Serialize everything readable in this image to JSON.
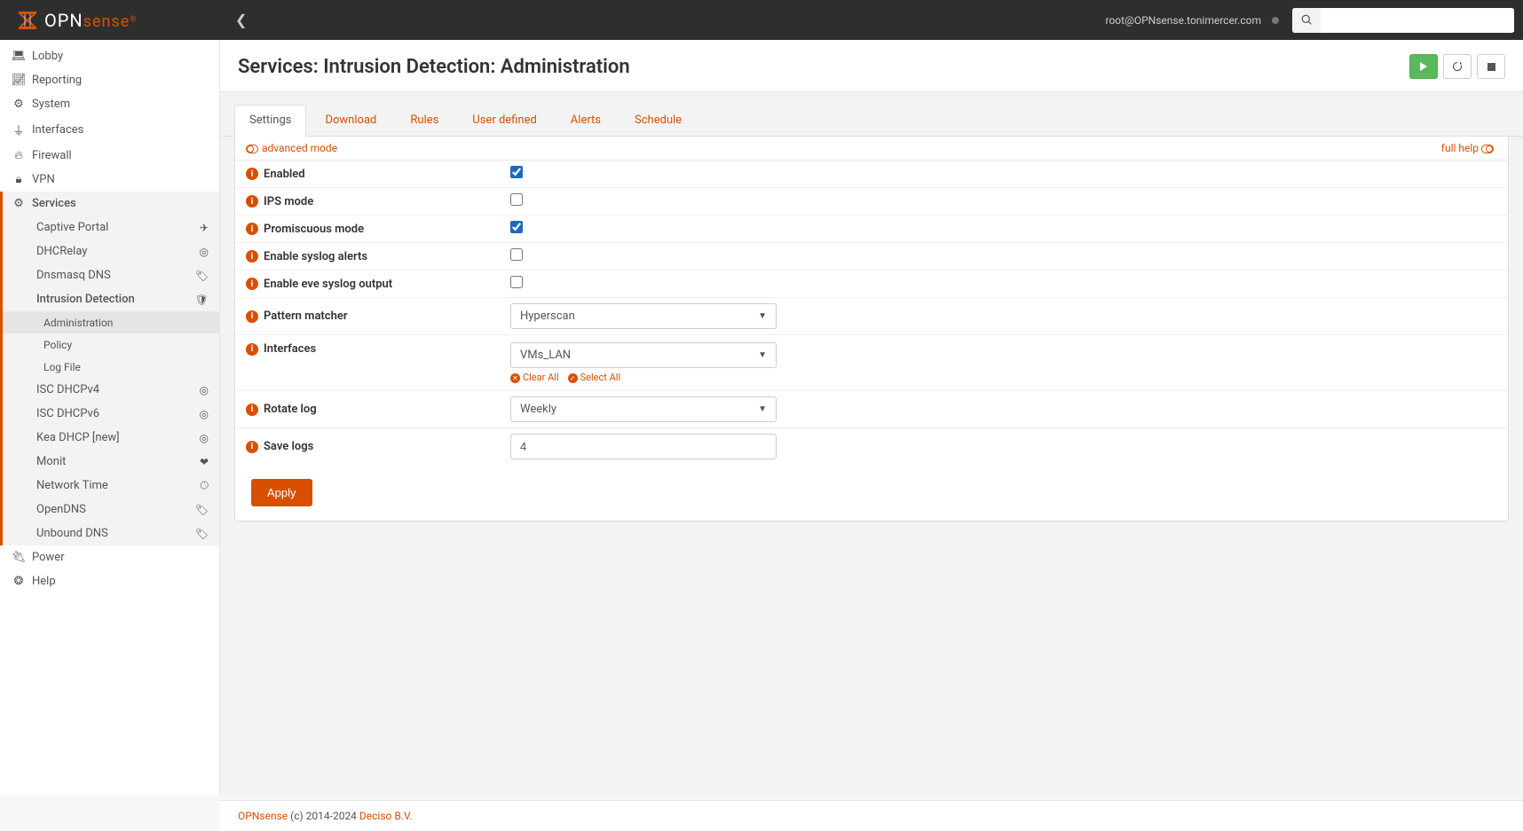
{
  "brand": {
    "text_left": "OPN",
    "text_right": "sense"
  },
  "user_label": "root@OPNsense.tonimercer.com",
  "search": {
    "placeholder": ""
  },
  "sidebar": {
    "top": [
      {
        "label": "Lobby"
      },
      {
        "label": "Reporting"
      },
      {
        "label": "System"
      },
      {
        "label": "Interfaces"
      },
      {
        "label": "Firewall"
      },
      {
        "label": "VPN"
      }
    ],
    "services_label": "Services",
    "services": [
      {
        "label": "Captive Portal"
      },
      {
        "label": "DHCRelay"
      },
      {
        "label": "Dnsmasq DNS"
      },
      {
        "label": "Intrusion Detection"
      },
      {
        "label": "ISC DHCPv4"
      },
      {
        "label": "ISC DHCPv6"
      },
      {
        "label": "Kea DHCP [new]"
      },
      {
        "label": "Monit"
      },
      {
        "label": "Network Time"
      },
      {
        "label": "OpenDNS"
      },
      {
        "label": "Unbound DNS"
      }
    ],
    "ids_children": [
      {
        "label": "Administration"
      },
      {
        "label": "Policy"
      },
      {
        "label": "Log File"
      }
    ],
    "bottom": [
      {
        "label": "Power"
      },
      {
        "label": "Help"
      }
    ]
  },
  "page": {
    "title": "Services: Intrusion Detection: Administration",
    "tabs": [
      "Settings",
      "Download",
      "Rules",
      "User defined",
      "Alerts",
      "Schedule"
    ],
    "advanced_label": "advanced mode",
    "full_help_label": "full help",
    "apply_label": "Apply"
  },
  "form": {
    "enabled": {
      "label": "Enabled",
      "checked": true
    },
    "ips": {
      "label": "IPS mode",
      "checked": false
    },
    "promiscuous": {
      "label": "Promiscuous mode",
      "checked": true
    },
    "syslog": {
      "label": "Enable syslog alerts",
      "checked": false
    },
    "eve": {
      "label": "Enable eve syslog output",
      "checked": false
    },
    "pattern": {
      "label": "Pattern matcher",
      "value": "Hyperscan"
    },
    "interfaces": {
      "label": "Interfaces",
      "value": "VMs_LAN",
      "clear": "Clear All",
      "select": "Select All"
    },
    "rotate": {
      "label": "Rotate log",
      "value": "Weekly"
    },
    "savelogs": {
      "label": "Save logs",
      "value": "4"
    }
  },
  "footer": {
    "brand": "OPNsense",
    "mid": " (c) 2014-2024 ",
    "company": "Deciso B.V."
  }
}
